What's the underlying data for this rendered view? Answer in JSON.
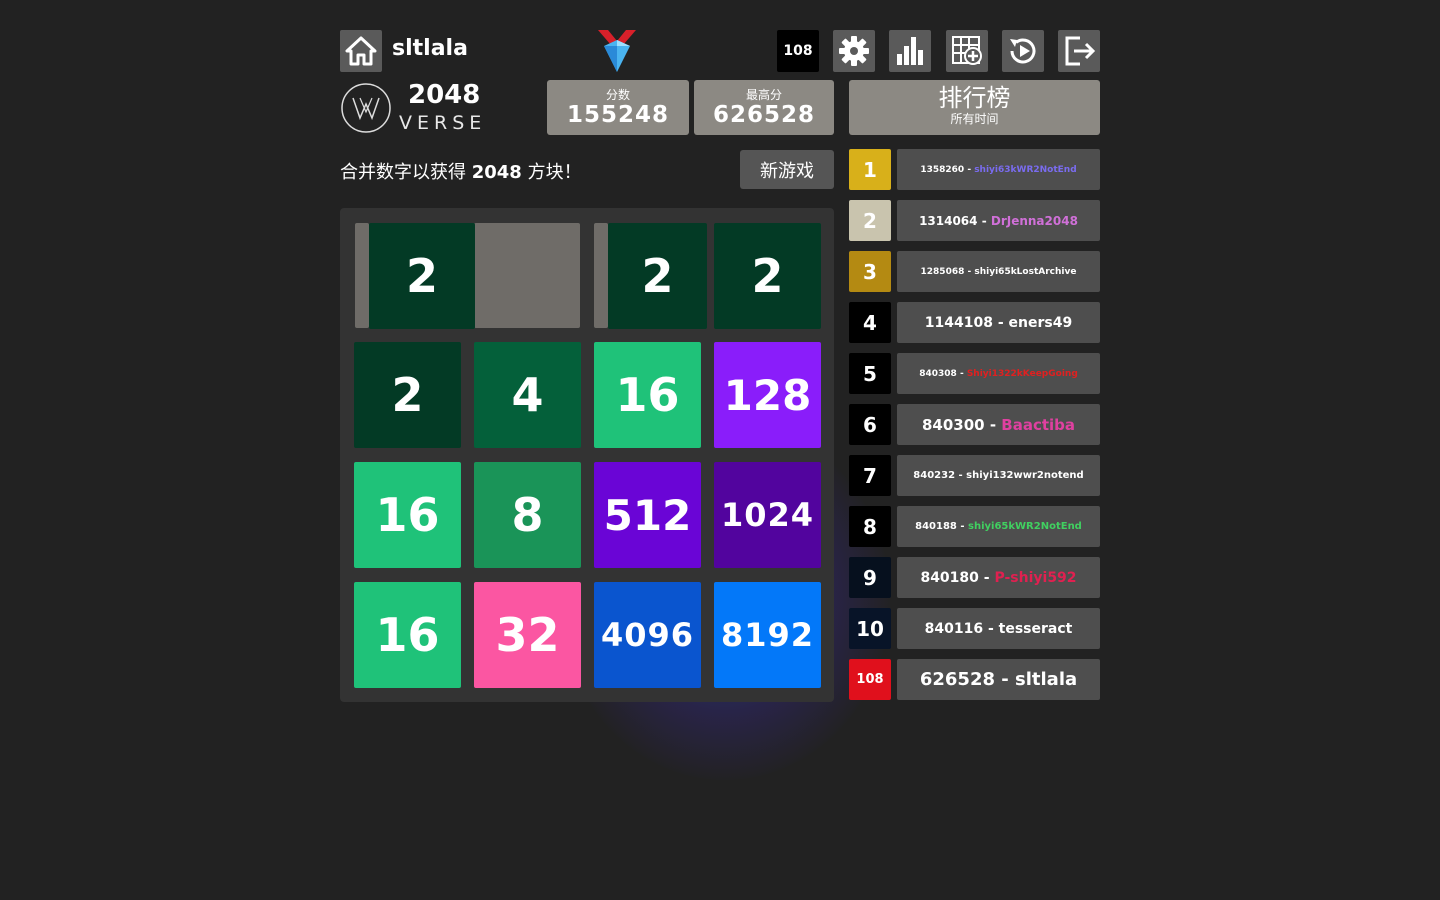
{
  "header": {
    "username": "sltlala",
    "rank_badge": "108",
    "icons": [
      "home-icon",
      "gem-logo-icon",
      "gear-icon",
      "stats-icon",
      "new-grid-icon",
      "replay-icon",
      "logout-icon"
    ]
  },
  "brand": {
    "title": "2048",
    "subtitle": "VERSE"
  },
  "scores": {
    "score_label": "分数",
    "score_value": "155248",
    "best_label": "最高分",
    "best_value": "626528"
  },
  "leaderboard": {
    "title": "排行榜",
    "subtitle": "所有时间",
    "entries": [
      {
        "rank": "1",
        "score": "1358260",
        "name": "shiyi63kWR2NotEnd",
        "rank_bg": "#d8b01a",
        "name_color": "#7a6cf0",
        "size": 9
      },
      {
        "rank": "2",
        "score": "1314064",
        "name": "DrJenna2048",
        "rank_bg": "#c9c4ae",
        "name_color": "#d070d8",
        "size": 12
      },
      {
        "rank": "3",
        "score": "1285068",
        "name": "shiyi65kLostArchive",
        "rank_bg": "#b48a12",
        "name_color": "#ffffff",
        "size": 9
      },
      {
        "rank": "4",
        "score": "1144108",
        "name": "eners49",
        "rank_bg": "#000000",
        "name_color": "#ffffff",
        "size": 14
      },
      {
        "rank": "5",
        "score": "840308",
        "name": "Shiyi1322kKeepGoing",
        "rank_bg": "#000000",
        "name_color": "#e02020",
        "size": 9
      },
      {
        "rank": "6",
        "score": "840300",
        "name": "Baactiba",
        "rank_bg": "#000000",
        "name_color": "#e040a0",
        "size": 15
      },
      {
        "rank": "7",
        "score": "840232",
        "name": "shiyi132wwr2notend",
        "rank_bg": "#000000",
        "name_color": "#ffffff",
        "size": 10
      },
      {
        "rank": "8",
        "score": "840188",
        "name": "shiyi65kWR2NotEnd",
        "rank_bg": "#000000",
        "name_color": "#40d060",
        "size": 10
      },
      {
        "rank": "9",
        "score": "840180",
        "name": "P-shiyi592",
        "rank_bg": "#06101e",
        "name_color": "#e02050",
        "size": 14
      },
      {
        "rank": "10",
        "score": "840116",
        "name": "tesseract",
        "rank_bg": "#081428",
        "name_color": "#ffffff",
        "size": 14
      },
      {
        "rank": "108",
        "score": "626528",
        "name": "sltlala",
        "rank_bg": "#e0101c",
        "name_color": "#ffffff",
        "size": 18
      }
    ]
  },
  "game": {
    "intro_pre": "合并数字以获得 ",
    "intro_bold": "2048",
    "intro_post": " 方块！",
    "new_game_label": "新游戏",
    "tiles": [
      {
        "row": 0,
        "col": 0,
        "value": "2",
        "color": "#033a25",
        "text": "#ffffff"
      },
      {
        "row": 0,
        "col": 2,
        "value": "2",
        "color": "#033a25",
        "text": "#ffffff"
      },
      {
        "row": 0,
        "col": 3,
        "value": "2",
        "color": "#033a25",
        "text": "#ffffff"
      },
      {
        "row": 1,
        "col": 0,
        "value": "2",
        "color": "#033a25",
        "text": "#ffffff"
      },
      {
        "row": 1,
        "col": 1,
        "value": "4",
        "color": "#04603a",
        "text": "#ffffff"
      },
      {
        "row": 1,
        "col": 2,
        "value": "16",
        "color": "#1fc279",
        "text": "#ffffff"
      },
      {
        "row": 1,
        "col": 3,
        "value": "128",
        "color": "#8a1dfa",
        "text": "#ffffff"
      },
      {
        "row": 2,
        "col": 0,
        "value": "16",
        "color": "#1fc279",
        "text": "#ffffff"
      },
      {
        "row": 2,
        "col": 1,
        "value": "8",
        "color": "#1a9458",
        "text": "#ffffff"
      },
      {
        "row": 2,
        "col": 2,
        "value": "512",
        "color": "#6a05d6",
        "text": "#ffffff"
      },
      {
        "row": 2,
        "col": 3,
        "value": "1024",
        "color": "#52049e",
        "text": "#ffffff"
      },
      {
        "row": 3,
        "col": 0,
        "value": "16",
        "color": "#1fc279",
        "text": "#ffffff"
      },
      {
        "row": 3,
        "col": 1,
        "value": "32",
        "color": "#fb56a2",
        "text": "#ffffff"
      },
      {
        "row": 3,
        "col": 2,
        "value": "4096",
        "color": "#0a55cf",
        "text": "#ffffff"
      },
      {
        "row": 3,
        "col": 3,
        "value": "8192",
        "color": "#0378f9",
        "text": "#ffffff"
      }
    ]
  }
}
